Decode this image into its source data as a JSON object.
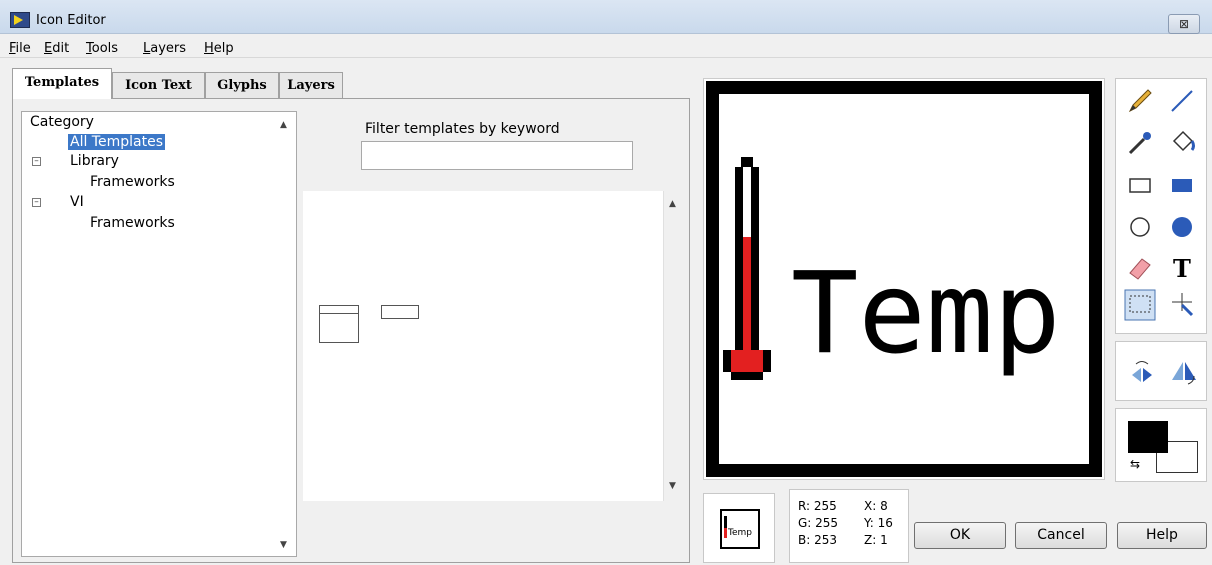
{
  "window": {
    "title": "Icon Editor",
    "close_label": "⊠"
  },
  "menu": [
    "File",
    "Edit",
    "Tools",
    "Layers",
    "Help"
  ],
  "tabs": [
    "Templates",
    "Icon Text",
    "Glyphs",
    "Layers"
  ],
  "category": {
    "header": "Category",
    "items": [
      {
        "label": "All Templates",
        "selected": true
      },
      {
        "label": "Library"
      },
      {
        "label": "Frameworks"
      },
      {
        "label": "VI"
      },
      {
        "label": "Frameworks"
      }
    ]
  },
  "filter": {
    "label": "Filter templates by keyword",
    "value": ""
  },
  "canvas": {
    "text": "Temp",
    "thermometer_color": "#e32020",
    "frame_color": "#000000"
  },
  "preview": {
    "text": "Temp"
  },
  "pixel_info": {
    "r": "R: 255",
    "g": "G: 255",
    "b": "B: 253",
    "x": "X: 8",
    "y": "Y: 16",
    "z": "Z: 1"
  },
  "colors": {
    "foreground": "#000000",
    "background": "#ffffff"
  },
  "tools": [
    "pencil-icon",
    "line-icon",
    "eyedropper-icon",
    "fill-bucket-icon",
    "rectangle-icon",
    "filled-rectangle-icon",
    "ellipse-icon",
    "filled-ellipse-icon",
    "eraser-icon",
    "text-icon",
    "select-icon",
    "move-icon"
  ],
  "buttons": {
    "ok": "OK",
    "cancel": "Cancel",
    "help": "Help"
  }
}
